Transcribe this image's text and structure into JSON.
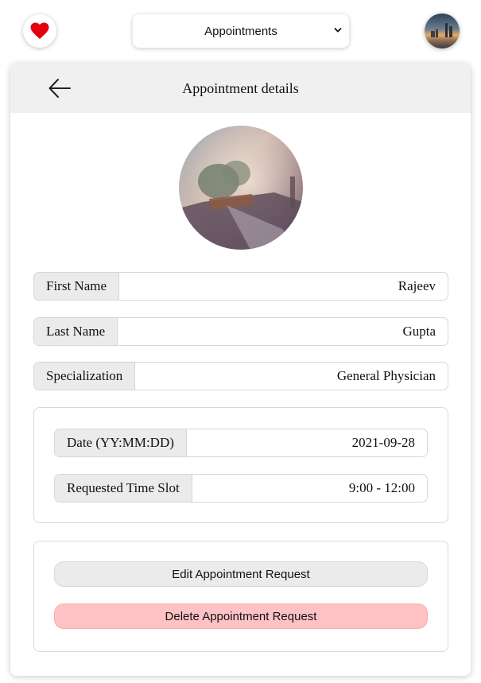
{
  "nav": {
    "heart_icon": "heart-icon",
    "heart_color": "#e3000f",
    "select_value": "Appointments",
    "chevron_icon": "chevron-down-icon"
  },
  "card": {
    "title": "Appointment details",
    "back_icon": "arrow-left-icon",
    "header_bg": "#f0f0f0"
  },
  "doctor": {
    "first_name_label": "First Name",
    "first_name": "Rajeev",
    "last_name_label": "Last Name",
    "last_name": "Gupta",
    "specialization_label": "Specialization",
    "specialization": "General Physician"
  },
  "appointment": {
    "date_label": "Date (YY:MM:DD)",
    "date": "2021-09-28",
    "time_slot_label": "Requested Time Slot",
    "time_slot": "9:00 - 12:00"
  },
  "actions": {
    "edit_label": "Edit Appointment Request",
    "delete_label": "Delete Appointment Request",
    "delete_color": "#ffc2c4"
  }
}
